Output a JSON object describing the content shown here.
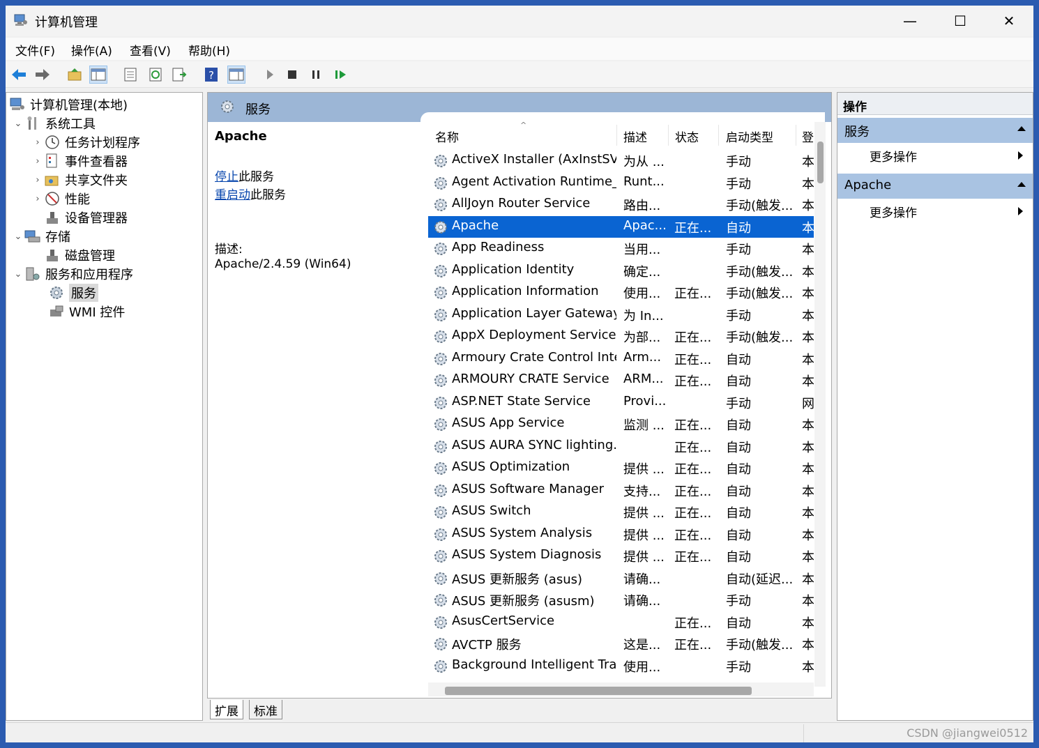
{
  "window": {
    "title": "计算机管理",
    "controls": {
      "minimize": "—",
      "maximize": "☐",
      "close": "✕"
    }
  },
  "menu": [
    "文件(F)",
    "操作(A)",
    "查看(V)",
    "帮助(H)"
  ],
  "toolbar": {
    "buttons": [
      "back-icon",
      "forward-icon",
      "up-folder-icon",
      "show-hide-tree-icon",
      "properties-icon",
      "refresh-icon",
      "export-list-icon",
      "help-icon",
      "show-hide-action-pane-icon",
      "start-service-icon",
      "stop-service-icon",
      "pause-service-icon",
      "resume-service-icon"
    ]
  },
  "tree": [
    {
      "label": "计算机管理(本地)",
      "icon": "computer-management-icon"
    },
    {
      "label": "系统工具",
      "icon": "tools-icon"
    },
    {
      "label": "任务计划程序",
      "icon": "clock-icon"
    },
    {
      "label": "事件查看器",
      "icon": "event-viewer-icon"
    },
    {
      "label": "共享文件夹",
      "icon": "shared-folder-icon"
    },
    {
      "label": "性能",
      "icon": "performance-icon"
    },
    {
      "label": "设备管理器",
      "icon": "device-manager-icon"
    },
    {
      "label": "存储",
      "icon": "storage-icon"
    },
    {
      "label": "磁盘管理",
      "icon": "disk-icon"
    },
    {
      "label": "服务和应用程序",
      "icon": "services-apps-icon"
    },
    {
      "label": "服务",
      "icon": "gear-icon"
    },
    {
      "label": "WMI 控件",
      "icon": "wmi-icon"
    }
  ],
  "middle": {
    "header": "服务",
    "selected_name": "Apache",
    "stop_link": "停止",
    "stop_suffix": "此服务",
    "restart_link": "重启动",
    "restart_suffix": "此服务",
    "desc_label": "描述:",
    "desc_text": "Apache/2.4.59 (Win64)",
    "columns": {
      "name": "名称",
      "desc": "描述",
      "state": "状态",
      "start": "启动类型",
      "logon": "登"
    },
    "sort_arrow": "^",
    "rows": [
      {
        "name": "ActiveX Installer (AxInstSV)",
        "desc": "为从 ...",
        "state": "",
        "start": "手动",
        "logon": "本"
      },
      {
        "name": "Agent Activation Runtime_...",
        "desc": "Runt...",
        "state": "",
        "start": "手动",
        "logon": "本"
      },
      {
        "name": "AllJoyn Router Service",
        "desc": "路由...",
        "state": "",
        "start": "手动(触发...",
        "logon": "本"
      },
      {
        "name": "Apache",
        "desc": "Apac...",
        "state": "正在...",
        "start": "自动",
        "logon": "本",
        "selected": true
      },
      {
        "name": "App Readiness",
        "desc": "当用...",
        "state": "",
        "start": "手动",
        "logon": "本"
      },
      {
        "name": "Application Identity",
        "desc": "确定...",
        "state": "",
        "start": "手动(触发...",
        "logon": "本"
      },
      {
        "name": "Application Information",
        "desc": "使用...",
        "state": "正在...",
        "start": "手动(触发...",
        "logon": "本"
      },
      {
        "name": "Application Layer Gateway ...",
        "desc": "为 In...",
        "state": "",
        "start": "手动",
        "logon": "本"
      },
      {
        "name": "AppX Deployment Service ...",
        "desc": "为部...",
        "state": "正在...",
        "start": "手动(触发...",
        "logon": "本"
      },
      {
        "name": "Armoury Crate Control Inte...",
        "desc": "Arm...",
        "state": "正在...",
        "start": "自动",
        "logon": "本"
      },
      {
        "name": "ARMOURY CRATE Service",
        "desc": "ARM...",
        "state": "正在...",
        "start": "自动",
        "logon": "本"
      },
      {
        "name": "ASP.NET State Service",
        "desc": "Provi...",
        "state": "",
        "start": "手动",
        "logon": "网"
      },
      {
        "name": "ASUS App Service",
        "desc": "监测 ...",
        "state": "正在...",
        "start": "自动",
        "logon": "本"
      },
      {
        "name": "ASUS AURA SYNC lighting...",
        "desc": "",
        "state": "正在...",
        "start": "自动",
        "logon": "本"
      },
      {
        "name": "ASUS Optimization",
        "desc": "提供 ...",
        "state": "正在...",
        "start": "自动",
        "logon": "本"
      },
      {
        "name": "ASUS Software Manager",
        "desc": "支持...",
        "state": "正在...",
        "start": "自动",
        "logon": "本"
      },
      {
        "name": "ASUS Switch",
        "desc": "提供 ...",
        "state": "正在...",
        "start": "自动",
        "logon": "本"
      },
      {
        "name": "ASUS System Analysis",
        "desc": "提供 ...",
        "state": "正在...",
        "start": "自动",
        "logon": "本"
      },
      {
        "name": "ASUS System Diagnosis",
        "desc": "提供 ...",
        "state": "正在...",
        "start": "自动",
        "logon": "本"
      },
      {
        "name": "ASUS 更新服务 (asus)",
        "desc": "请确...",
        "state": "",
        "start": "自动(延迟...",
        "logon": "本"
      },
      {
        "name": "ASUS 更新服务 (asusm)",
        "desc": "请确...",
        "state": "",
        "start": "手动",
        "logon": "本"
      },
      {
        "name": "AsusCertService",
        "desc": "",
        "state": "正在...",
        "start": "自动",
        "logon": "本"
      },
      {
        "name": "AVCTP 服务",
        "desc": "这是...",
        "state": "正在...",
        "start": "手动(触发...",
        "logon": "本"
      },
      {
        "name": "Background Intelligent Tra...",
        "desc": "使用...",
        "state": "",
        "start": "手动",
        "logon": "本"
      }
    ],
    "tabs": [
      "扩展",
      "标准"
    ]
  },
  "actions": {
    "header": "操作",
    "sections": [
      {
        "title": "服务",
        "item": "更多操作"
      },
      {
        "title": "Apache",
        "item": "更多操作"
      }
    ]
  },
  "status": {
    "watermark": "CSDN @jiangwei0512"
  },
  "colors": {
    "selection": "#0a64d2",
    "pane_header": "#9cb6d6",
    "action_section": "#a9c3e2",
    "link": "#0645ad"
  }
}
